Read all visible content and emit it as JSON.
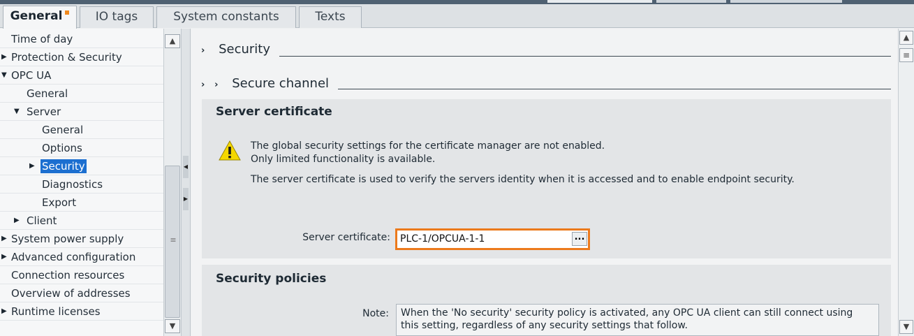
{
  "tabs": [
    {
      "label": "General",
      "active": true,
      "modified": true
    },
    {
      "label": "IO tags",
      "active": false
    },
    {
      "label": "System constants",
      "active": false
    },
    {
      "label": "Texts",
      "active": false
    }
  ],
  "nav": {
    "items": [
      {
        "label": "Time of day",
        "expander": ""
      },
      {
        "label": "Protection & Security",
        "expander": "right"
      },
      {
        "label": "OPC UA",
        "expander": "down"
      },
      {
        "label": "General",
        "expander": ""
      },
      {
        "label": "Server",
        "expander": "down"
      },
      {
        "label": "General",
        "expander": ""
      },
      {
        "label": "Options",
        "expander": ""
      },
      {
        "label": "Security",
        "expander": "right",
        "selected": true
      },
      {
        "label": "Diagnostics",
        "expander": ""
      },
      {
        "label": "Export",
        "expander": ""
      },
      {
        "label": "Client",
        "expander": "right"
      },
      {
        "label": "System power supply",
        "expander": "right"
      },
      {
        "label": "Advanced configuration",
        "expander": "right"
      },
      {
        "label": "Connection resources",
        "expander": ""
      },
      {
        "label": "Overview of addresses",
        "expander": ""
      },
      {
        "label": "Runtime licenses",
        "expander": "right"
      }
    ]
  },
  "main": {
    "security_heading": "Security",
    "secure_channel_heading": "Secure channel",
    "server_certificate": {
      "title": "Server certificate",
      "warning_line1": "The global security settings for the certificate manager are not enabled.",
      "warning_line2": "Only limited functionality is available.",
      "description": "The server certificate is used to verify the servers identity when it is accessed and to enable endpoint security.",
      "field_label": "Server certificate:",
      "field_value": "PLC-1/OPCUA-1-1",
      "browse_label": "..."
    },
    "security_policies": {
      "title": "Security policies",
      "note_label": "Note:",
      "note_line1": "When the 'No security' security policy is activated, any OPC UA client can still connect using",
      "note_line2": "this setting, regardless of any security settings that follow."
    }
  },
  "colors": {
    "highlight": "#ec7a1c",
    "selection": "#1c6fd0",
    "modified_marker": "#f08a1e",
    "warning_yellow": "#f5d800"
  }
}
